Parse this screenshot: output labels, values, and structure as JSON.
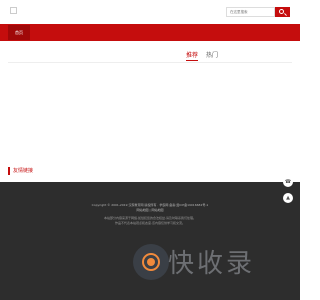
{
  "header": {
    "search_placeholder": "在这里搜索"
  },
  "nav": {
    "home_label": "首页"
  },
  "tabs": [
    {
      "label": "推荐"
    },
    {
      "label": "热门"
    }
  ],
  "friend_links": {
    "title": "友情链接"
  },
  "footer": {
    "copyright": "Copyright © 2001-2019 汉家教育网 版权所有 · 学霸网 备案:冀ICP备19016682号-1",
    "sitemap": "网站地图 | 网站地图",
    "note_line1": "本站部分内容来源于网络,如侵犯您的合法权益,请及时联系我们处理。",
    "note_line2": "作品不代表本站观点和态度,该内容仅供学习和交流。"
  },
  "side_buttons": [
    {
      "icon": "phone-icon"
    },
    {
      "icon": "arrow-up-icon"
    }
  ],
  "watermark": {
    "text": "快收录"
  },
  "colors": {
    "brand_red": "#c50d0d",
    "footer_bg": "#2d2d2d"
  }
}
